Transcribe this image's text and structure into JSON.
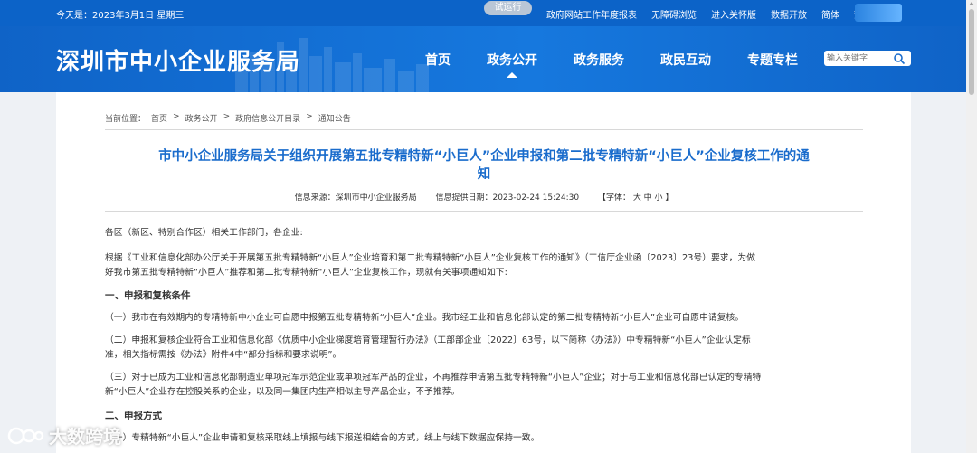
{
  "topbar": {
    "date": "今天是：2023年3月1日 星期三",
    "trial_badge": "试运行",
    "links": [
      "政府网站工作年度报表",
      "无障碍浏览",
      "进入关怀版",
      "数据开放",
      "简体",
      "繁体"
    ]
  },
  "header": {
    "site_title": "深圳市中小企业服务局",
    "nav": [
      "首页",
      "政务公开",
      "政务服务",
      "政民互动",
      "专题专栏"
    ],
    "active_nav": "政务公开",
    "search_placeholder": "输入关键字"
  },
  "breadcrumb": [
    "当前位置：",
    "首页",
    ">",
    "政务公开",
    ">",
    "政府信息公开目录",
    ">",
    "通知公告"
  ],
  "article": {
    "title_line1": "市中小企业服务局关于组织开展第五批专精特新“小巨人”企业申报和第二批专精特新“小巨人”企业复核工作的通",
    "title_line2": "知",
    "source": "信息来源：深圳市中小企业服务局",
    "date": "信息提供日期：2023-02-24 15:24:30",
    "font_size": "【字体： 大  中  小 】",
    "paragraphs": [
      "各区（新区、特别合作区）相关工作部门，各企业:",
      "      根据《工业和信息化部办公厅关于开展第五批专精特新“小巨人”企业培育和第二批专精特新“小巨人”企业复核工作的通知》（工信厅企业函〔2023〕23号）要求，为做",
      "好我市第五批专精特新“小巨人”推荐和第二批专精特新“小巨人”企业复核工作，现就有关事项通知如下:",
      "    一、申报和复核条件",
      "    （一）我市在有效期内的专精特新中小企业可自愿申报第五批专精特新“小巨人”企业。我市经工业和信息化部认定的第二批专精特新“小巨人”企业可自愿申请复核。",
      "    （二）申报和复核企业符合工业和信息化部《优质中小企业梯度培育管理暂行办法》（工部部企业〔2022〕63号，以下简称《办法》）中专精特新“小巨人”企业认定标",
      "准，相关指标需按《办法》附件4中“部分指标和要求说明”。",
      "    （三）对于已成为工业和信息化部制造业单项冠军示范企业或单项冠军产品的企业，不再推荐申请第五批专精特新“小巨人”企业；对于与工业和信息化部已认定的专精特",
      "新“小巨人”企业存在控股关系的企业，以及同一集团内生产相似主导产品企业，不予推荐。",
      "    二、申报方式",
      "    （一）专精特新“小巨人”企业申请和复核采取线上填报与线下报送相结合的方式，线上与线下数据应保持一致。"
    ]
  },
  "watermark": "大数跨境"
}
